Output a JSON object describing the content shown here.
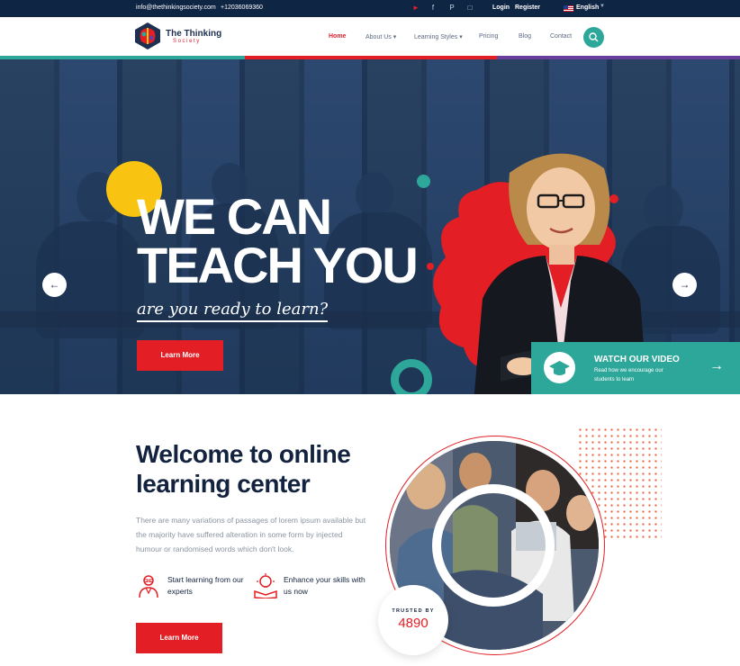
{
  "topbar": {
    "email": "info@thethinkingsociety.com",
    "phone": "+12036069360",
    "social_icons": [
      "twitter-icon",
      "facebook-icon",
      "pinterest-icon",
      "instagram-icon"
    ],
    "login": "Login",
    "register": "Register",
    "language": "English"
  },
  "header": {
    "logo_title": "The Thinking",
    "logo_sub": "Society",
    "nav": [
      "Home",
      "About Us",
      "Learning Styles",
      "Pricing",
      "Blog",
      "Contact"
    ],
    "active_nav": "Home"
  },
  "colors": {
    "accent_red": "#e31e24",
    "accent_teal": "#2da79a",
    "accent_yellow": "#f8c411",
    "accent_purple": "#6a3f9c",
    "navy": "#0f2544"
  },
  "hero": {
    "headline_1": "WE CAN",
    "headline_2": "TEACH YOU",
    "subline": "are you ready to learn?",
    "button": "Learn More",
    "video_title": "WATCH OUR VIDEO",
    "video_sub": "Read how we encourage our students to learn"
  },
  "welcome": {
    "title": "Welcome to online learning center",
    "body": "There are many variations of passages of lorem ipsum available but the majority have suffered alteration in some form by injected humour or randomised words which don't look.",
    "feature_1": "Start learning from our experts",
    "feature_2": "Enhance your skills with us now",
    "button": "Learn More",
    "trusted_label": "TRUSTED BY",
    "trusted_count": "4890"
  }
}
